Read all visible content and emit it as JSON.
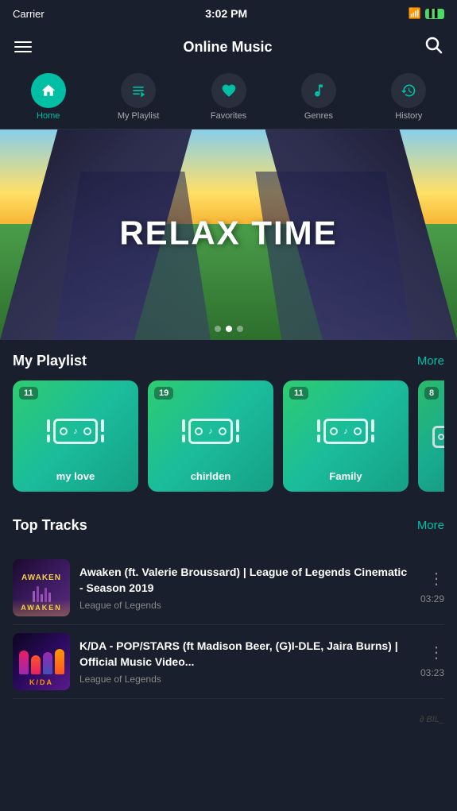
{
  "statusBar": {
    "carrier": "Carrier",
    "time": "3:02 PM",
    "battery": "▌"
  },
  "header": {
    "title": "Online Music",
    "searchLabel": "search"
  },
  "navTabs": [
    {
      "id": "home",
      "label": "Home",
      "icon": "🏠",
      "active": true
    },
    {
      "id": "playlist",
      "label": "My Playlist",
      "icon": "🎵",
      "active": false
    },
    {
      "id": "favorites",
      "label": "Favorites",
      "icon": "♥",
      "active": false
    },
    {
      "id": "genres",
      "label": "Genres",
      "icon": "🎶",
      "active": false
    },
    {
      "id": "history",
      "label": "History",
      "icon": "🕐",
      "active": false
    }
  ],
  "hero": {
    "text": "RELAX TIME",
    "dots": [
      false,
      true,
      false
    ]
  },
  "playlist": {
    "sectionTitle": "My Playlist",
    "moreLabel": "More",
    "cards": [
      {
        "id": "my-love",
        "name": "my love",
        "count": "11",
        "gradient": "teal"
      },
      {
        "id": "chirlden",
        "name": "chirlden",
        "count": "19",
        "gradient": "teal"
      },
      {
        "id": "family",
        "name": "Family",
        "count": "11",
        "gradient": "teal"
      },
      {
        "id": "extra",
        "name": "...",
        "count": "8",
        "gradient": "teal"
      }
    ]
  },
  "topTracks": {
    "sectionTitle": "Top Tracks",
    "moreLabel": "More",
    "tracks": [
      {
        "id": "awaken",
        "title": "Awaken (ft. Valerie Broussard) | League of Legends Cinematic - Season 2019",
        "artist": "League of Legends",
        "duration": "03:29",
        "thumbType": "awaken",
        "thumbLabel": "AWAKEN"
      },
      {
        "id": "kda",
        "title": "K/DA - POP/STARS (ft Madison Beer, (G)I-DLE, Jaira Burns) | Official Music Video...",
        "artist": "League of Legends",
        "duration": "03:23",
        "thumbType": "kda",
        "thumbLabel": "K/DA"
      }
    ]
  },
  "logo": "∂ BIL_"
}
